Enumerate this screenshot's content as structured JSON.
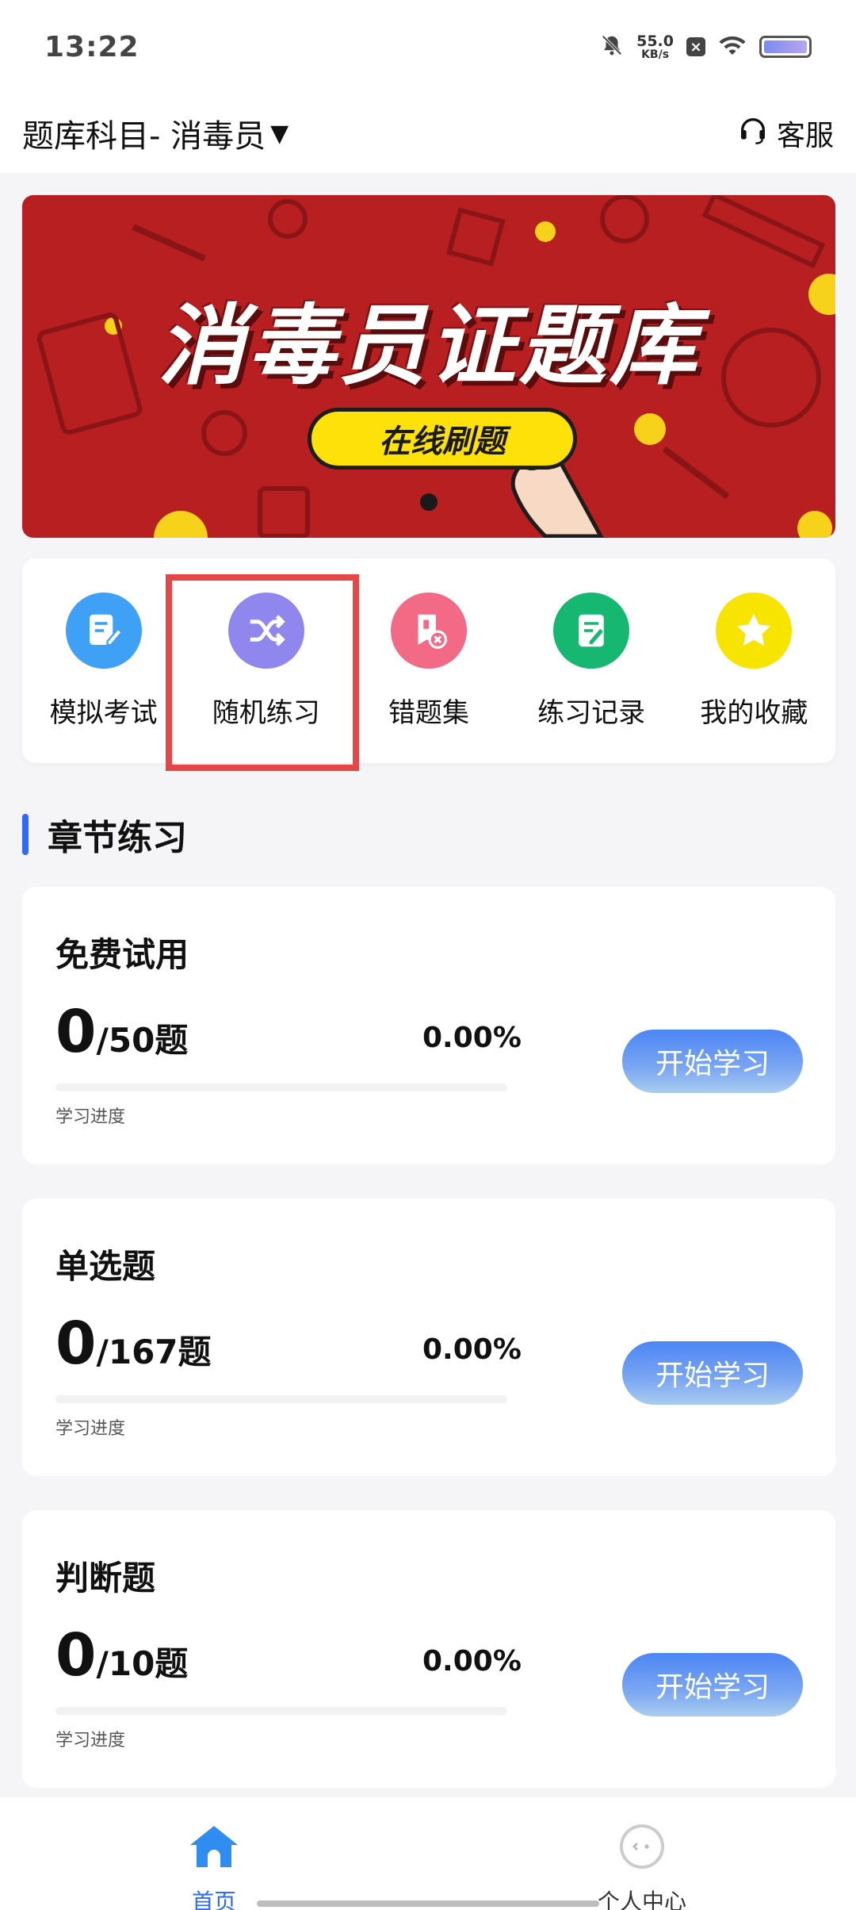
{
  "status_bar": {
    "time": "13:22",
    "net_speed_value": "55.0",
    "net_speed_unit": "KB/s",
    "icons": [
      "mute-bell-icon",
      "close-box-icon",
      "wifi-icon",
      "battery-icon"
    ]
  },
  "header": {
    "subject_title": "题库科目- 消毒员",
    "caret": "▼",
    "service_label": "客服"
  },
  "banner": {
    "title": "消毒员证题库",
    "pill_label": "在线刷题"
  },
  "quick_menu": [
    {
      "label": "模拟考试",
      "icon": "edit-doc-icon",
      "color": "#3ea1f5"
    },
    {
      "label": "随机练习",
      "icon": "shuffle-icon",
      "color": "#8f86ee"
    },
    {
      "label": "错题集",
      "icon": "wrong-book-icon",
      "color": "#f26a86"
    },
    {
      "label": "练习记录",
      "icon": "record-doc-icon",
      "color": "#16b871"
    },
    {
      "label": "我的收藏",
      "icon": "star-icon",
      "color": "#f7e400"
    }
  ],
  "section": {
    "title": "章节练习"
  },
  "cards": [
    {
      "title": "免费试用",
      "done": "0",
      "total": "/50题",
      "percent": "0.00%",
      "progress": 0,
      "progress_label": "学习进度",
      "button": "开始学习"
    },
    {
      "title": "单选题",
      "done": "0",
      "total": "/167题",
      "percent": "0.00%",
      "progress": 0,
      "progress_label": "学习进度",
      "button": "开始学习"
    },
    {
      "title": "判断题",
      "done": "0",
      "total": "/10题",
      "percent": "0.00%",
      "progress": 0,
      "progress_label": "学习进度",
      "button": "开始学习"
    }
  ],
  "bottom_nav": [
    {
      "label": "首页",
      "icon": "home-icon",
      "active": true
    },
    {
      "label": "个人中心",
      "icon": "profile-face-icon",
      "active": false
    }
  ],
  "colors": {
    "accent": "#2f6bf6",
    "banner": "#b81f21",
    "highlight": "#e64646"
  }
}
